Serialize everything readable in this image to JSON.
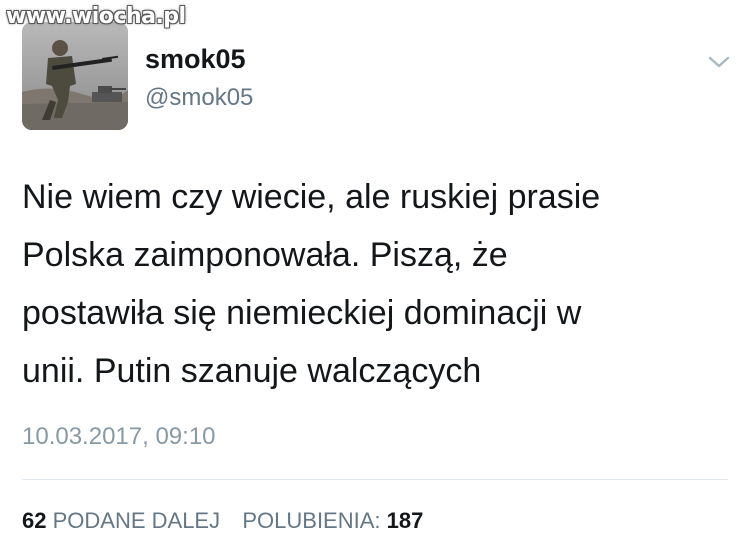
{
  "watermark": "www.wiocha.pl",
  "user": {
    "display_name": "smok05",
    "handle": "@smok05",
    "avatar_icon": "soldier-avatar"
  },
  "menu_icon": "chevron-down-icon",
  "tweet": {
    "text": "Nie wiem czy wiecie, ale ruskiej prasie\nPolska zaimponowała. Piszą, że\npostawiła się niemieckiej dominacji w\nunii. Putin szanuje walczących",
    "timestamp": "10.03.2017, 09:10"
  },
  "stats": {
    "retweets_count": "62",
    "retweets_label": "PODANE DALEJ",
    "likes_label": "POLUBIENIA:",
    "likes_count": "187"
  },
  "colors": {
    "text": "#14171a",
    "secondary": "#657786",
    "timestamp": "#8899a6",
    "divider": "#e1e8ed"
  }
}
